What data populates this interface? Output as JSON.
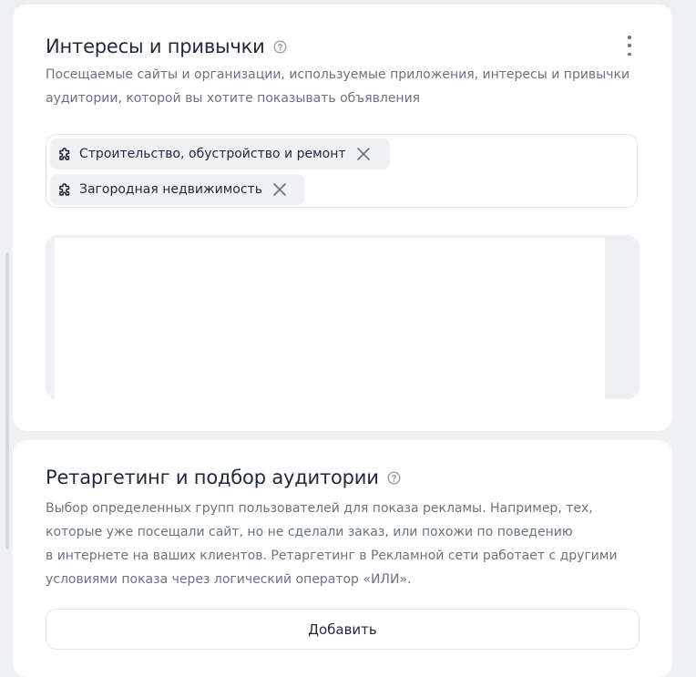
{
  "interests": {
    "title": "Интересы и привычки",
    "description_line1": "Посещаемые сайты и организации, используемые приложения, интересы и привычки",
    "description_line2": "аудитории, которой вы хотите показывать объявления",
    "tags": [
      {
        "label": "Строительство, обустройство и ремонт",
        "icon": "puzzle-icon"
      },
      {
        "label": "Загородная недвижимость",
        "icon": "puzzle-icon"
      }
    ],
    "menu_icon": "kebab-menu-icon",
    "help_icon": "question-circle-icon"
  },
  "retargeting": {
    "title": "Ретаргетинг и подбор аудитории",
    "description_line1": "Выбор определенных групп пользователей для показа рекламы. Например, тех,",
    "description_line2": "которые уже посещали сайт, но не сделали заказ, или похожи по поведению",
    "description_line3": "в интернете на ваших клиентов. Ретаргетинг в Рекламной сети работает с другими",
    "description_line4": "условиями показа через логический оператор «ИЛИ».",
    "add_button_label": "Добавить",
    "help_icon": "question-circle-icon"
  },
  "colors": {
    "background": "#eef0f4",
    "card": "#ffffff",
    "text_primary": "#1f2937",
    "text_secondary": "#6b7280",
    "border": "#e2e5ea"
  }
}
